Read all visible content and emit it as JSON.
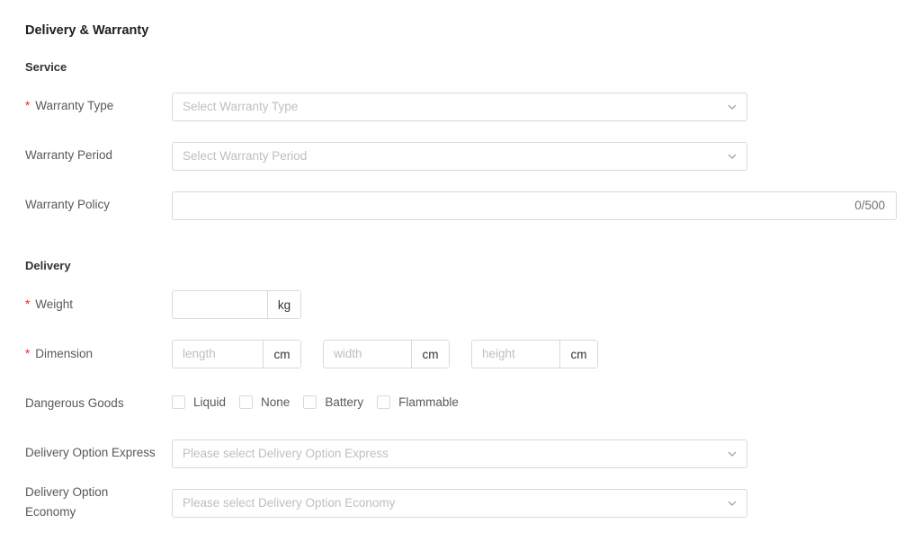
{
  "title": "Delivery & Warranty",
  "service": {
    "heading": "Service",
    "warranty_type": {
      "label": "Warranty Type",
      "required_mark": "*",
      "placeholder": "Select Warranty Type"
    },
    "warranty_period": {
      "label": "Warranty Period",
      "placeholder": "Select Warranty Period"
    },
    "warranty_policy": {
      "label": "Warranty Policy",
      "counter": "0/500"
    }
  },
  "delivery": {
    "heading": "Delivery",
    "weight": {
      "label": "Weight",
      "required_mark": "*",
      "unit": "kg"
    },
    "dimension": {
      "label": "Dimension",
      "required_mark": "*",
      "length": {
        "placeholder": "length",
        "unit": "cm"
      },
      "width": {
        "placeholder": "width",
        "unit": "cm"
      },
      "height": {
        "placeholder": "height",
        "unit": "cm"
      }
    },
    "dangerous_goods": {
      "label": "Dangerous Goods",
      "options": [
        "Liquid",
        "None",
        "Battery",
        "Flammable"
      ]
    },
    "express": {
      "label": "Delivery Option Express",
      "placeholder": "Please select Delivery Option Express"
    },
    "economy": {
      "label_line1": "Delivery Option",
      "label_line2": "Economy",
      "placeholder": "Please select Delivery Option Economy"
    }
  },
  "icons": {
    "chevron": "chevron-down-icon"
  },
  "colors": {
    "required": "#f5222d",
    "border": "#d9d9d9",
    "placeholder": "#bfbfbf"
  }
}
